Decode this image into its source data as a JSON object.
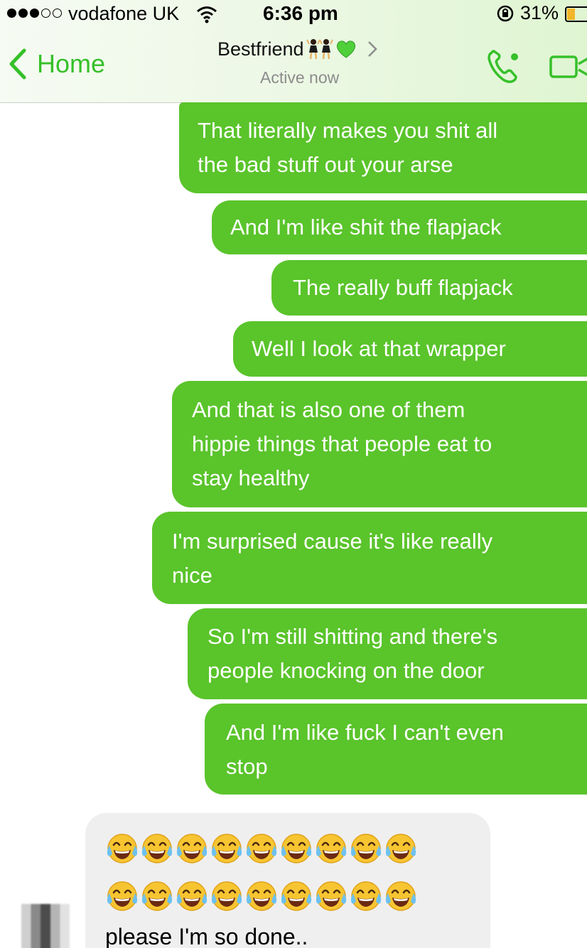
{
  "status_bar": {
    "carrier": "vodafone UK",
    "time": "6:36 pm",
    "battery": "31%",
    "signal_bars_filled": 3,
    "signal_bars_total": 5
  },
  "nav": {
    "back_label": "Home",
    "contact_name": "Bestfriend",
    "contact_status": "Active now",
    "accent_color": "#36c02a"
  },
  "messages": {
    "outgoing": [
      "That literally makes you shit all\nthe bad stuff out your arse",
      "And I'm like shit the flapjack",
      "The really buff flapjack",
      "Well I look at that wrapper",
      "And that is also one of them\nhippie things that people eat to\nstay healthy",
      "I'm surprised cause it's like really\nnice",
      "So I'm still shitting and there's\npeople knocking on the door",
      "And I'm like fuck I can't even\nstop"
    ],
    "incoming": {
      "emoji_name": "face-with-tears-of-joy-icon",
      "emoji_rows": [
        9,
        9
      ],
      "text": "please I'm so done.."
    }
  },
  "colors": {
    "outgoing_bubble": "#5ac42b",
    "incoming_bubble": "#efefef"
  }
}
